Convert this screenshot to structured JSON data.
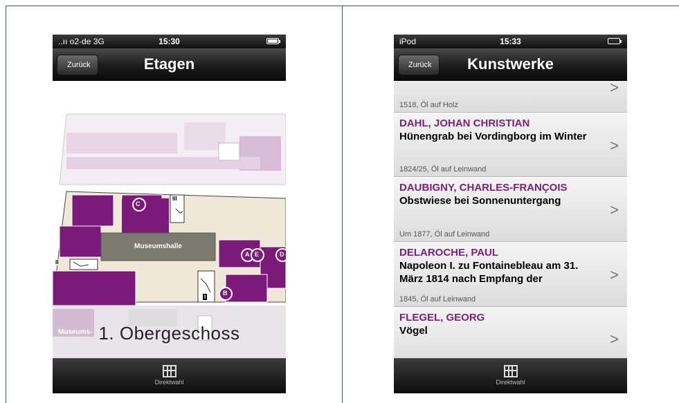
{
  "phone1": {
    "status": {
      "carrier": "..ıı o2-de  3G",
      "time": "15:30"
    },
    "nav": {
      "back_label": "Zurück",
      "title": "Etagen"
    },
    "map": {
      "hall_label": "Museumshalle",
      "faded_label": "Museums-",
      "floor_label": "1. Obergeschoss",
      "markers": [
        "C",
        "A",
        "E",
        "D",
        "B"
      ],
      "stair_tags": [
        "III",
        "II",
        "I"
      ]
    },
    "tab": {
      "label": "Direktwahl",
      "icon": "grid-icon"
    }
  },
  "phone2": {
    "status": {
      "carrier": "iPod",
      "time": "15:33"
    },
    "nav": {
      "back_label": "Zurück",
      "title": "Kunstwerke"
    },
    "list": [
      {
        "artist": "",
        "work": "",
        "meta": "1518, Öl auf Holz"
      },
      {
        "artist": "DAHL, JOHAN CHRISTIAN",
        "work": "Hünengrab bei Vordingborg im Winter",
        "meta": "1824/25, Öl auf Leinwand"
      },
      {
        "artist": "DAUBIGNY, CHARLES-FRANÇOIS",
        "work": "Obstwiese bei Sonnenuntergang",
        "meta": "Um 1877, Öl auf Leinwand"
      },
      {
        "artist": "DELAROCHE, PAUL",
        "work": "Napoleon I. zu Fontainebleau am 31. März 1814 nach Empfang der",
        "meta": "1845, Öl auf Leinwand"
      },
      {
        "artist": "FLEGEL, GEORG",
        "work": "Vögel",
        "meta": ""
      }
    ],
    "tab": {
      "label": "Direktwahl",
      "icon": "grid-icon"
    }
  },
  "colors": {
    "accent": "#7d1e7a",
    "map_purple": "#7b1a78",
    "hall_gray": "#7c7a6e"
  }
}
